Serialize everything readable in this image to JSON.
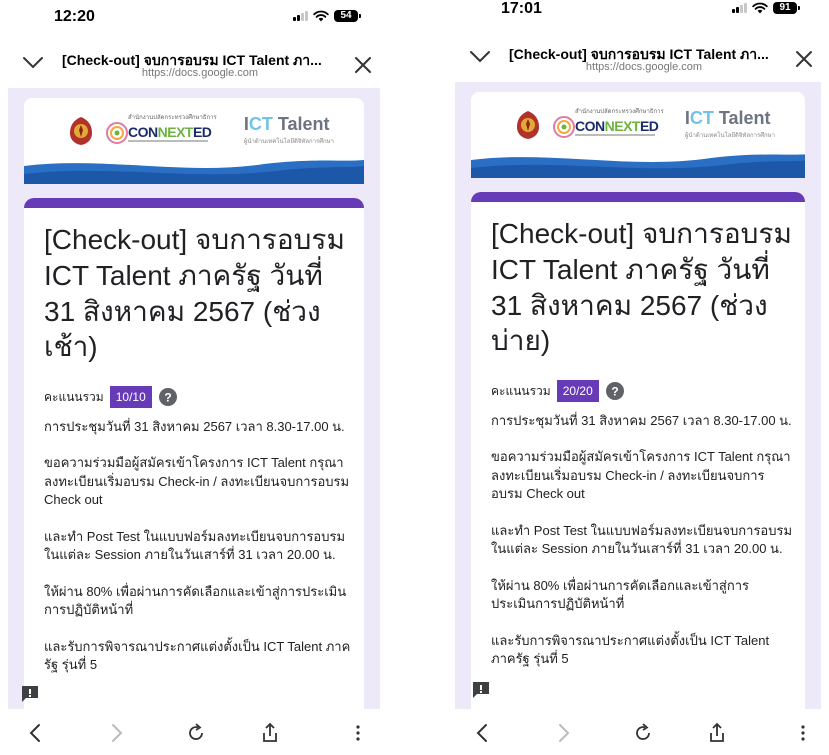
{
  "screens": [
    {
      "status": {
        "time": "12:20",
        "battery": "54"
      },
      "browser": {
        "title": "[Check-out] จบการอบรม ICT Talent ภา...",
        "url": "https://docs.google.com"
      },
      "form": {
        "title": "[Check-out] จบการอบรม ICT Talent ภาครัฐ วันที่ 31 สิงหาคม 2567 (ช่วงเช้า)",
        "score_label": "คะแนนรวม",
        "score_value": "10/10",
        "paragraphs": [
          "การประชุมวันที่ 31 สิงหาคม 2567 เวลา 8.30-17.00 น.",
          "ขอความร่วมมือผู้สมัครเข้าโครงการ ICT Talent กรุณา ลงทะเบียนเริ่มอบรม Check-in / ลงทะเบียนจบการอบรม Check out",
          "และทำ Post Test ในแบบฟอร์มลงทะเบียนจบการอบรมในแต่ละ Session  ภายในวันเสาร์ที่  31 เวลา 20.00 น.",
          "ให้ผ่าน 80% เพื่อผ่านการคัดเลือกและเข้าสู่การประเมินการปฏิบัติหน้าที่",
          "และรับการพิจารณาประกาศแต่งตั้งเป็น ICT Talent ภาครัฐ รุ่นที่ 5"
        ]
      }
    },
    {
      "status": {
        "time": "17:01",
        "battery": "91"
      },
      "browser": {
        "title": "[Check-out] จบการอบรม ICT Talent ภา...",
        "url": "https://docs.google.com"
      },
      "form": {
        "title": "[Check-out] จบการอบรม ICT Talent ภาครัฐ วันที่ 31 สิงหาคม 2567 (ช่วงบ่าย)",
        "score_label": "คะแนนรวม",
        "score_value": "20/20",
        "paragraphs": [
          "การประชุมวันที่ 31 สิงหาคม 2567 เวลา 8.30-17.00 น.",
          "ขอความร่วมมือผู้สมัครเข้าโครงการ ICT Talent กรุณา ลงทะเบียนเริ่มอบรม Check-in / ลงทะเบียนจบการอบรม Check out",
          "และทำ Post Test ในแบบฟอร์มลงทะเบียนจบการอบรมในแต่ละ Session  ภายในวันเสาร์ที่  31 เวลา 20.00 น.",
          "ให้ผ่าน 80% เพื่อผ่านการคัดเลือกและเข้าสู่การประเมินการปฏิบัติหน้าที่",
          "และรับการพิจารณาประกาศแต่งตั้งเป็น ICT Talent ภาครัฐ รุ่นที่ 5"
        ]
      }
    }
  ],
  "banner": {
    "connexted_caption": "สำนักงานปลัดกระทรวงศึกษาธิการ",
    "connexted_prefix": "CON",
    "connexted_highlight": "NEXT",
    "connexted_suffix": "ED",
    "ict_prefix": "I",
    "ict_highlight": "CT",
    "ict_suffix": " Talent",
    "ict_caption": "ผู้นำด้านเทคโนโลยีดิจิทัลการศึกษา"
  },
  "icons": [
    "chevron-down-icon",
    "close-icon",
    "help-icon",
    "report-icon",
    "back-icon",
    "forward-icon",
    "reload-icon",
    "share-icon",
    "more-icon",
    "wifi-icon",
    "signal-icon",
    "battery-icon"
  ],
  "colors": {
    "form_accent": "#673ab7",
    "page_background": "#ede9f8",
    "ict_accent": "#6fc4e8",
    "connexted_green": "#6cb33f",
    "connexted_navy": "#1b2b6a"
  }
}
